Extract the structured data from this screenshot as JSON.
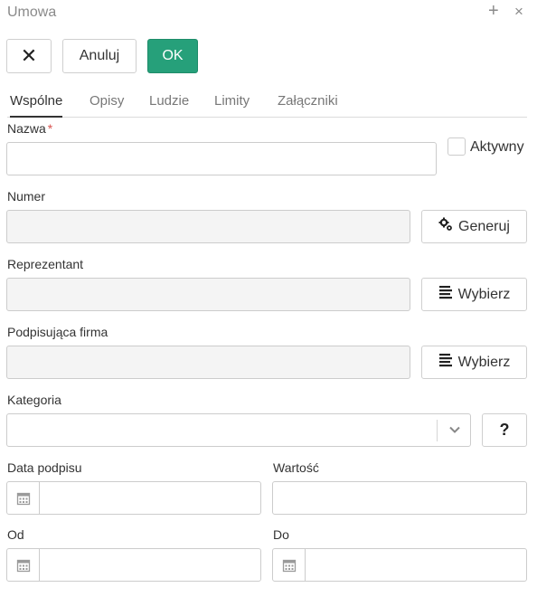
{
  "window": {
    "title": "Umowa",
    "plus_icon": "+",
    "close_icon": "×"
  },
  "toolbar": {
    "close_glyph": "✕",
    "cancel_label": "Anuluj",
    "ok_label": "OK",
    "ok_color": "#26a07a"
  },
  "tabs": [
    {
      "label": "Wspólne",
      "active": true
    },
    {
      "label": "Opisy"
    },
    {
      "label": "Ludzie"
    },
    {
      "label": "Limity"
    },
    {
      "label": "Załączniki"
    }
  ],
  "form": {
    "nazwa": {
      "label": "Nazwa",
      "required_mark": "*",
      "value": ""
    },
    "aktywny": {
      "label": "Aktywny",
      "checked": false
    },
    "numer": {
      "label": "Numer",
      "value": "",
      "button": "Generuj",
      "icon": "gears-icon"
    },
    "reprezentant": {
      "label": "Reprezentant",
      "value": "",
      "button": "Wybierz",
      "icon": "list-icon"
    },
    "firma": {
      "label": "Podpisująca firma",
      "value": "",
      "button": "Wybierz",
      "icon": "list-icon"
    },
    "kategoria": {
      "label": "Kategoria",
      "value": "",
      "help": "?"
    },
    "data_podpisu": {
      "label": "Data podpisu",
      "value": ""
    },
    "wartosc": {
      "label": "Wartość",
      "value": ""
    },
    "od": {
      "label": "Od",
      "value": ""
    },
    "do": {
      "label": "Do",
      "value": ""
    }
  }
}
